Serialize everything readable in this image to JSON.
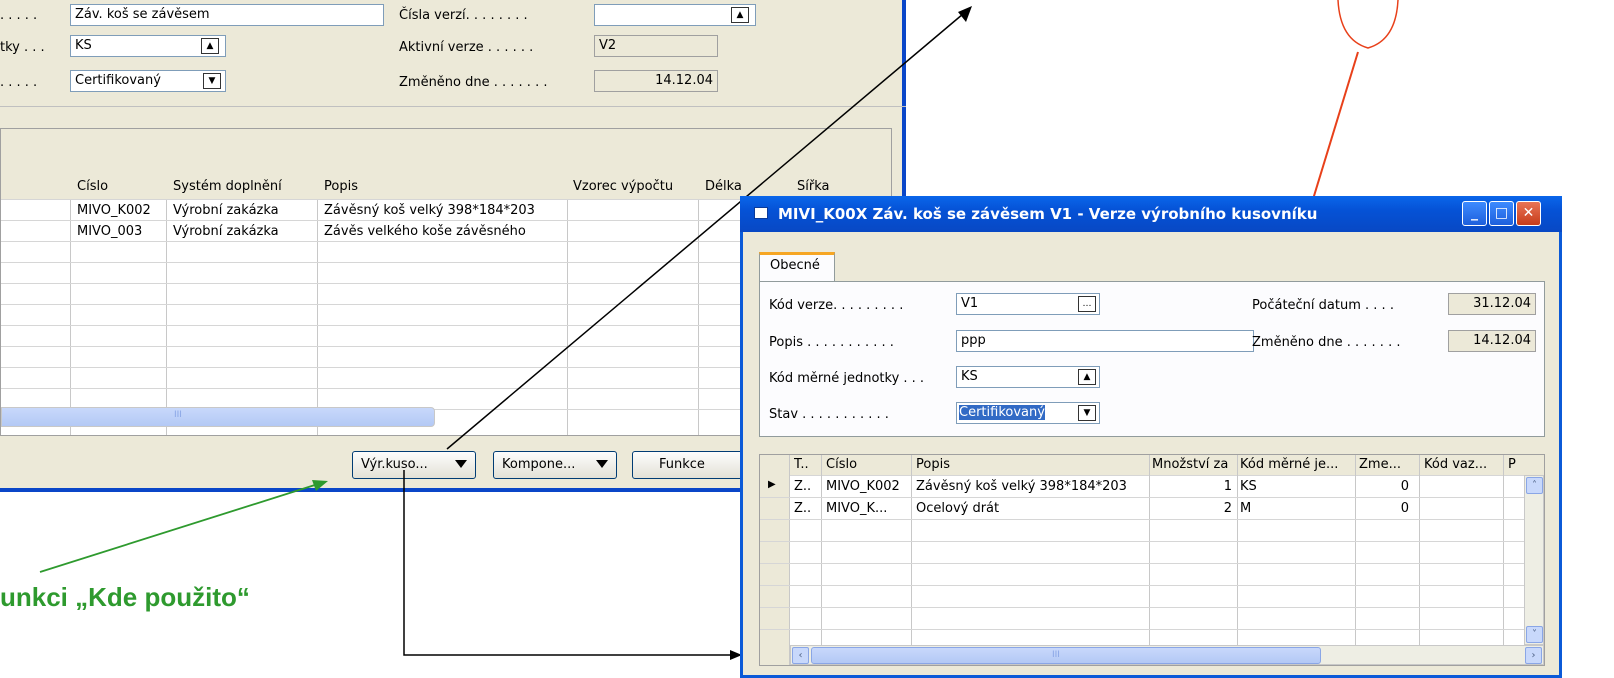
{
  "back_window": {
    "header_fields": {
      "popis": "Záv. koš se závěsem",
      "jednotky_label_fragment": "tky . . .",
      "jednotka": "KS",
      "stav": "Certifikovaný",
      "cisla_verzi_label": "Čísla verzí. . . . . . . .",
      "cisla_verzi_value": "",
      "aktivni_verze_label": "Aktivní verze . . . . . .",
      "aktivni_verze_value": "V2",
      "zmeneno_label": "Změněno dne . . . . . . .",
      "zmeneno_value": "14.12.04",
      "dots1": ". . . . .",
      "dots3": ". . . . ."
    },
    "grid": {
      "columns": [
        "Číslo",
        "Systém doplnění",
        "Popis",
        "Vzorec výpočtu",
        "Délka",
        "Šířka"
      ],
      "rows": [
        [
          "MIVO_K002",
          "Výrobní zakázka",
          "Závěsný koš velký 398*184*203"
        ],
        [
          "MIVO_003",
          "Výrobní zakázka",
          "Závěs velkého koše závěsného"
        ]
      ]
    },
    "buttons": {
      "vyr_kusovnik": "Výr.kuso...",
      "komponenty": "Kompone...",
      "funkce": "Funkce"
    }
  },
  "front_window": {
    "title": "MIVI_K00X Záv. koš se závěsem V1 - Verze výrobního kusovníku",
    "tab": "Obecné",
    "fields": {
      "kod_verze_label": "Kód verze. . . . . . . . .",
      "kod_verze_value": "V1",
      "popis_label": "Popis . . . . . . . . . . .",
      "popis_value": "ppp",
      "kod_jednotky_label": "Kód měrné jednotky . . .",
      "kod_jednotky_value": "KS",
      "stav_label": "Stav . . . . . . . . . . .",
      "stav_value": "Certifikovaný",
      "pocatecni_label": "Počáteční datum . . . .",
      "pocatecni_value": "31.12.04",
      "zmeneno_label": "Změněno dne . . . . . . .",
      "zmeneno_value": "14.12.04"
    },
    "grid": {
      "columns": [
        "T..",
        "Číslo",
        "Popis",
        "Množství za",
        "Kód měrné je...",
        "Zme...",
        "Kód vaz...",
        "P"
      ],
      "rows": [
        [
          "Z..",
          "MIVO_K002",
          "Závěsný koš velký 398*184*203",
          "1",
          "KS",
          "0",
          ""
        ],
        [
          "Z..",
          "MIVO_K...",
          "Ocelový drát",
          "2",
          "M",
          "0",
          ""
        ]
      ]
    },
    "scroll_marker": "III"
  },
  "annotation": {
    "caption": "unkci „Kde použito“",
    "colors": {
      "green": "#2e9a2e",
      "red": "#e8401a",
      "black": "#000000",
      "xp_blue": "#0a46c8"
    }
  }
}
